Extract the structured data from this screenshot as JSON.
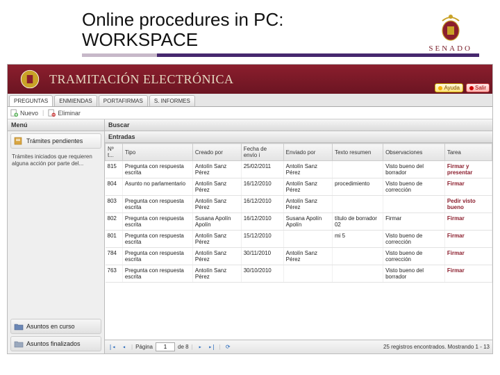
{
  "slide": {
    "title_line1": "Online procedures in PC:",
    "title_line2": "WORKSPACE",
    "logo_text": "SENADO"
  },
  "app": {
    "title": "TRAMITACIÓN ELECTRÓNICA",
    "help_label": "Ayuda",
    "exit_label": "Salir"
  },
  "tabs": [
    "PREGUNTAS",
    "ENMIENDAS",
    "PORTAFIRMAS",
    "S. INFORMES"
  ],
  "toolbar": {
    "new": "Nuevo",
    "del": "Eliminar"
  },
  "sidebar": {
    "head": "Menú",
    "item_pend": "Trámites pendientes",
    "desc": "Trámites iniciados que requieren alguna acción por parte del...",
    "item_curso": "Asuntos en curso",
    "item_final": "Asuntos finalizados"
  },
  "panel": {
    "buscar": "Buscar",
    "entradas": "Entradas"
  },
  "columns": [
    "Nº t...",
    "Tipo",
    "Creado por",
    "Fecha de envío i",
    "Enviado por",
    "Texto resumen",
    "Observaciones",
    "Tarea"
  ],
  "rows": [
    {
      "num": "815",
      "tipo": "Pregunta con respuesta escrita",
      "creado": "Antolín Sanz Pérez",
      "fecha": "25/02/2011",
      "enviado": "Antolín Sanz Pérez",
      "texto": "",
      "obs": "Visto bueno del borrador",
      "tarea": "Firmar y presentar"
    },
    {
      "num": "804",
      "tipo": "Asunto no parlamentario",
      "creado": "Antolín Sanz Pérez",
      "fecha": "16/12/2010",
      "enviado": "Antolín Sanz Pérez",
      "texto": "procedimiento",
      "obs": "Visto bueno de corrección",
      "tarea": "Firmar"
    },
    {
      "num": "803",
      "tipo": "Pregunta con respuesta escrita",
      "creado": "Antolín Sanz Pérez",
      "fecha": "16/12/2010",
      "enviado": "Antolín Sanz Pérez",
      "texto": "",
      "obs": "",
      "tarea": "Pedir visto bueno"
    },
    {
      "num": "802",
      "tipo": "Pregunta con respuesta escrita",
      "creado": "Susana Apolín Apolín",
      "fecha": "16/12/2010",
      "enviado": "Susana Apolín Apolín",
      "texto": "título de borrador 02",
      "obs": "Firmar",
      "tarea": "Firmar"
    },
    {
      "num": "801",
      "tipo": "Pregunta con respuesta escrita",
      "creado": "Antolín Sanz Pérez",
      "fecha": "15/12/2010",
      "enviado": "",
      "texto": "mi 5",
      "obs": "Visto bueno de corrección",
      "tarea": "Firmar"
    },
    {
      "num": "784",
      "tipo": "Pregunta con respuesta escrita",
      "creado": "Antolín Sanz Pérez",
      "fecha": "30/11/2010",
      "enviado": "Antolín Sanz Pérez",
      "texto": "",
      "obs": "Visto bueno de corrección",
      "tarea": "Firmar"
    },
    {
      "num": "763",
      "tipo": "Pregunta con respuesta escrita",
      "creado": "Antolín Sanz Pérez",
      "fecha": "30/10/2010",
      "enviado": "",
      "texto": "",
      "obs": "Visto bueno del borrador",
      "tarea": "Firmar"
    }
  ],
  "pager": {
    "page_label": "Página",
    "page_current": "1",
    "page_of": "de 8",
    "status": "25 registros encontrados. Mostrando 1 - 13"
  }
}
